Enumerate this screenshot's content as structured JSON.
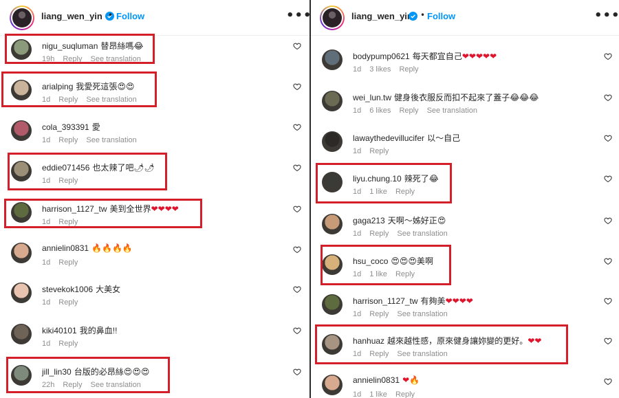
{
  "left": {
    "header": {
      "username": "liang_wen_yin",
      "dot": "•",
      "follow": "Follow",
      "more": "•••"
    },
    "comments": [
      {
        "user": "nigu_suqluman",
        "text": "替昂絲嗎😂",
        "time": "19h",
        "likes": "",
        "reply": "Reply",
        "translation": "See translation",
        "avatar": "#8a9a7a",
        "highlight": true
      },
      {
        "user": "arialping",
        "text": "我愛死這張😍😍",
        "time": "1d",
        "likes": "",
        "reply": "Reply",
        "translation": "See translation",
        "avatar": "#c9b39a",
        "highlight": true
      },
      {
        "user": "cola_393391",
        "text": "愛",
        "time": "1d",
        "likes": "",
        "reply": "Reply",
        "translation": "See translation",
        "avatar": "#b25a6a",
        "highlight": false
      },
      {
        "user": "eddie071456",
        "text": "也太辣了吧🌶🌶",
        "time": "1d",
        "likes": "",
        "reply": "Reply",
        "translation": "",
        "avatar": "#9c8f78",
        "highlight": true
      },
      {
        "user": "harrison_1127_tw",
        "text": "美到全世界❤❤❤❤",
        "time": "1d",
        "likes": "",
        "reply": "Reply",
        "translation": "",
        "avatar": "#5d6b3e",
        "highlight": true
      },
      {
        "user": "annielin0831",
        "text": "🔥🔥🔥🔥",
        "time": "1d",
        "likes": "",
        "reply": "Reply",
        "translation": "",
        "avatar": "#d7a98e",
        "highlight": false
      },
      {
        "user": "stevekok1006",
        "text": "大美女",
        "time": "1d",
        "likes": "",
        "reply": "Reply",
        "translation": "",
        "avatar": "#e8c3b0",
        "highlight": false
      },
      {
        "user": "kiki40101",
        "text": "我的鼻血!!",
        "time": "1d",
        "likes": "",
        "reply": "Reply",
        "translation": "",
        "avatar": "#6f6256",
        "highlight": false
      },
      {
        "user": "jill_lin30",
        "text": "台版的必昂絲😍😍😍",
        "time": "22h",
        "likes": "",
        "reply": "Reply",
        "translation": "See translation",
        "avatar": "#7d8a7c",
        "highlight": true
      }
    ]
  },
  "right": {
    "header": {
      "username": "liang_wen_yin",
      "dot": "•",
      "follow": "Follow",
      "more": "•••"
    },
    "comments": [
      {
        "user": "bodypump0621",
        "text": "每天都宜自己❤❤❤❤❤",
        "time": "1d",
        "likes": "3 likes",
        "reply": "Reply",
        "translation": "",
        "avatar": "#5f6e78",
        "highlight": false
      },
      {
        "user": "wei_lun.tw",
        "text": "健身後衣服反而扣不起來了蓋子😂😂😂",
        "time": "1d",
        "likes": "6 likes",
        "reply": "Reply",
        "translation": "See translation",
        "avatar": "#6b6a52",
        "highlight": false
      },
      {
        "user": "lawaythedevillucifer",
        "text": "以～自己",
        "time": "1d",
        "likes": "",
        "reply": "Reply",
        "translation": "",
        "avatar": "#2c2a26",
        "highlight": false
      },
      {
        "user": "liyu.chung.10",
        "text": "辣死了😂",
        "time": "1d",
        "likes": "1 like",
        "reply": "Reply",
        "translation": "",
        "avatar": "#3a3a36",
        "highlight": true
      },
      {
        "user": "gaga213",
        "text": "天啊～姊好正😍",
        "time": "1d",
        "likes": "",
        "reply": "Reply",
        "translation": "See translation",
        "avatar": "#c79a78",
        "highlight": false
      },
      {
        "user": "hsu_coco",
        "text": "😍😍😍美啊",
        "time": "1d",
        "likes": "1 like",
        "reply": "Reply",
        "translation": "",
        "avatar": "#d8b07a",
        "highlight": true
      },
      {
        "user": "harrison_1127_tw",
        "text": "有夠美❤❤❤❤",
        "time": "1d",
        "likes": "",
        "reply": "Reply",
        "translation": "See translation",
        "avatar": "#5d6b3e",
        "highlight": false
      },
      {
        "user": "hanhuaz",
        "text": "越來越性感，原來健身讓妳變的更好。❤❤",
        "time": "1d",
        "likes": "",
        "reply": "Reply",
        "translation": "See translation",
        "avatar": "#a89482",
        "highlight": true
      },
      {
        "user": "annielin0831",
        "text": "❤🔥",
        "time": "1d",
        "likes": "1 like",
        "reply": "Reply",
        "translation": "",
        "avatar": "#d7a98e",
        "highlight": false
      }
    ]
  }
}
